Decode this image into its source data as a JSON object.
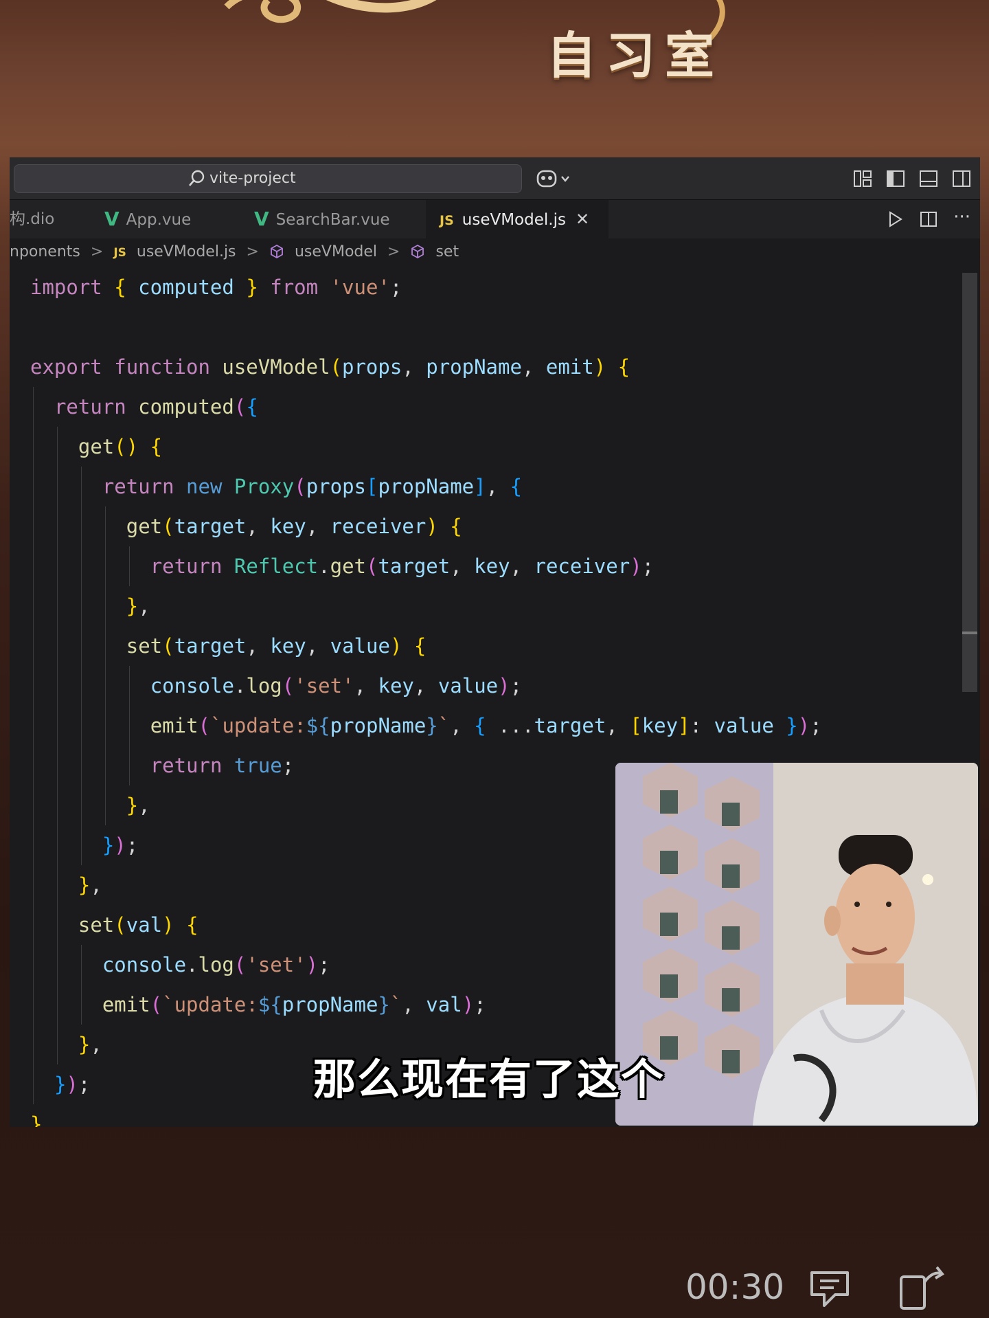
{
  "banner": {
    "title": "自习室"
  },
  "titlebar": {
    "search_text": "vite-project"
  },
  "tabs": [
    {
      "label": "构.dio",
      "kind": "file",
      "active": false
    },
    {
      "label": "App.vue",
      "kind": "vue",
      "active": false
    },
    {
      "label": "SearchBar.vue",
      "kind": "vue",
      "active": false
    },
    {
      "label": "useVModel.js",
      "kind": "js",
      "active": true
    }
  ],
  "tab_badge_js": "JS",
  "breadcrumb": {
    "folder": "nponents",
    "file": "useVModel.js",
    "function": "useVModel",
    "member": "set",
    "sep": ">"
  },
  "code_lines": [
    "import { computed } from 'vue';",
    "",
    "export function useVModel(props, propName, emit) {",
    "  return computed({",
    "    get() {",
    "      return new Proxy(props[propName], {",
    "        get(target, key, receiver) {",
    "          return Reflect.get(target, key, receiver);",
    "        },",
    "        set(target, key, value) {",
    "          console.log('set', key, value);",
    "          emit(`update:${propName}`, { ...target, [key]: value });",
    "          return true;",
    "        },",
    "      });",
    "    },",
    "    set(val) {",
    "      console.log('set');",
    "      emit(`update:${propName}`, val);",
    "    },",
    "  });",
    "}"
  ],
  "subtitle": "那么现在有了这个",
  "player": {
    "time": "00:30"
  },
  "icons": {
    "search": "search-icon",
    "copilot": "copilot-icon",
    "layout": "customize-layout-icon",
    "sidebar": "toggle-sidebar-icon",
    "panel": "toggle-panel-icon",
    "secondary": "toggle-secondary-sidebar-icon",
    "run": "run-icon",
    "split": "split-editor-icon",
    "more": "more-actions-icon",
    "close": "close-icon",
    "cube": "symbol-method-icon",
    "danmaku": "danmaku-icon",
    "rotate": "rotate-screen-icon"
  },
  "colors": {
    "accent_vue": "#41b883",
    "accent_js": "#e8c547",
    "editor_bg": "#1b1b1d"
  }
}
